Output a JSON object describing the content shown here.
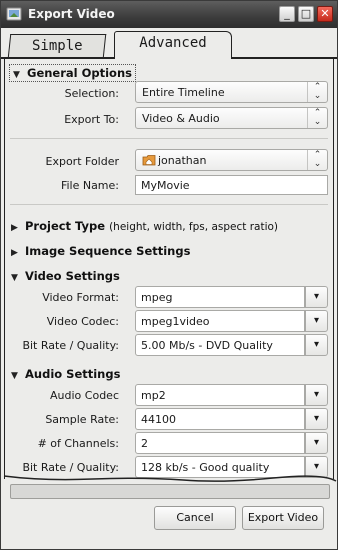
{
  "window": {
    "title": "Export Video",
    "minimize_glyph": "_",
    "maximize_glyph": "□",
    "close_glyph": "✕"
  },
  "tabs": [
    {
      "label": "Simple",
      "selected": false
    },
    {
      "label": "Advanced",
      "selected": true
    }
  ],
  "general": {
    "title": "General Options",
    "selection_label": "Selection:",
    "selection_value": "Entire Timeline",
    "export_to_label": "Export To:",
    "export_to_value": "Video & Audio",
    "folder_label": "Export Folder",
    "folder_value": "jonathan",
    "filename_label": "File Name:",
    "filename_value": "MyMovie"
  },
  "project_type": {
    "title": "Project Type",
    "hint": "(height, width, fps, aspect ratio)"
  },
  "image_sequence": {
    "title": "Image Sequence Settings"
  },
  "video": {
    "title": "Video Settings",
    "format_label": "Video Format:",
    "format_value": "mpeg",
    "codec_label": "Video Codec:",
    "codec_value": "mpeg1video",
    "bitrate_label": "Bit Rate / Quality:",
    "bitrate_value": "5.00 Mb/s - DVD Quality"
  },
  "audio": {
    "title": "Audio Settings",
    "codec_label": "Audio Codec",
    "codec_value": "mp2",
    "samplerate_label": "Sample Rate:",
    "samplerate_value": "44100",
    "channels_label": "# of Channels:",
    "channels_value": "2",
    "bitrate_label": "Bit Rate / Quality:",
    "bitrate_value": "128 kb/s - Good quality"
  },
  "progress": {
    "fraction": 0.0
  },
  "buttons": {
    "cancel": "Cancel",
    "export": "Export Video"
  },
  "icons": {
    "expanded": "expanded-triangle-icon",
    "collapsed": "collapsed-triangle-icon",
    "combo_arrows": "up-down-arrows-icon",
    "dropdown_arrow": "chevron-down-icon",
    "folder": "home-folder-icon"
  },
  "colors": {
    "titlebar": "#3c3c3c",
    "close_button": "#d9382a",
    "background": "#ececea"
  }
}
